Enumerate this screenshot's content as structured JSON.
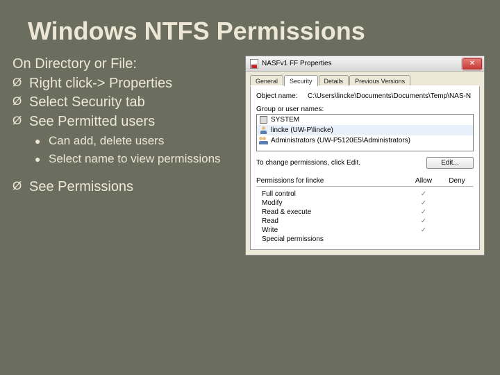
{
  "title": "Windows NTFS Permissions",
  "left": {
    "intro": "On Directory or File:",
    "b1": [
      "Right click-> Properties",
      "Select Security tab",
      "See Permitted users"
    ],
    "b2": [
      "Can add, delete users",
      "Select name to view permissions"
    ],
    "b1_last": "See Permissions",
    "mark": "Ø",
    "dot": "●"
  },
  "dialog": {
    "window_title": "NASFv1 FF Properties",
    "close_glyph": "✕",
    "tabs": [
      "General",
      "Security",
      "Details",
      "Previous Versions"
    ],
    "active_tab": 1,
    "object_label": "Object name:",
    "object_value": "C:\\Users\\lincke\\Documents\\Documents\\Temp\\NAS-N",
    "group_label": "Group or user names:",
    "users": [
      {
        "name": "SYSTEM",
        "icon": "sys"
      },
      {
        "name": "lincke (UW-P\\lincke)",
        "icon": "person"
      },
      {
        "name": "Administrators (UW-P5120E5\\Administrators)",
        "icon": "people"
      }
    ],
    "edit_text": "To change permissions, click Edit.",
    "edit_btn": "Edit...",
    "perm_for": "Permissions for lincke",
    "allow": "Allow",
    "deny": "Deny",
    "check": "✓",
    "perms": [
      {
        "name": "Full control",
        "allow": true,
        "deny": false
      },
      {
        "name": "Modify",
        "allow": true,
        "deny": false
      },
      {
        "name": "Read & execute",
        "allow": true,
        "deny": false
      },
      {
        "name": "Read",
        "allow": true,
        "deny": false
      },
      {
        "name": "Write",
        "allow": true,
        "deny": false
      },
      {
        "name": "Special permissions",
        "allow": false,
        "deny": false
      }
    ]
  }
}
